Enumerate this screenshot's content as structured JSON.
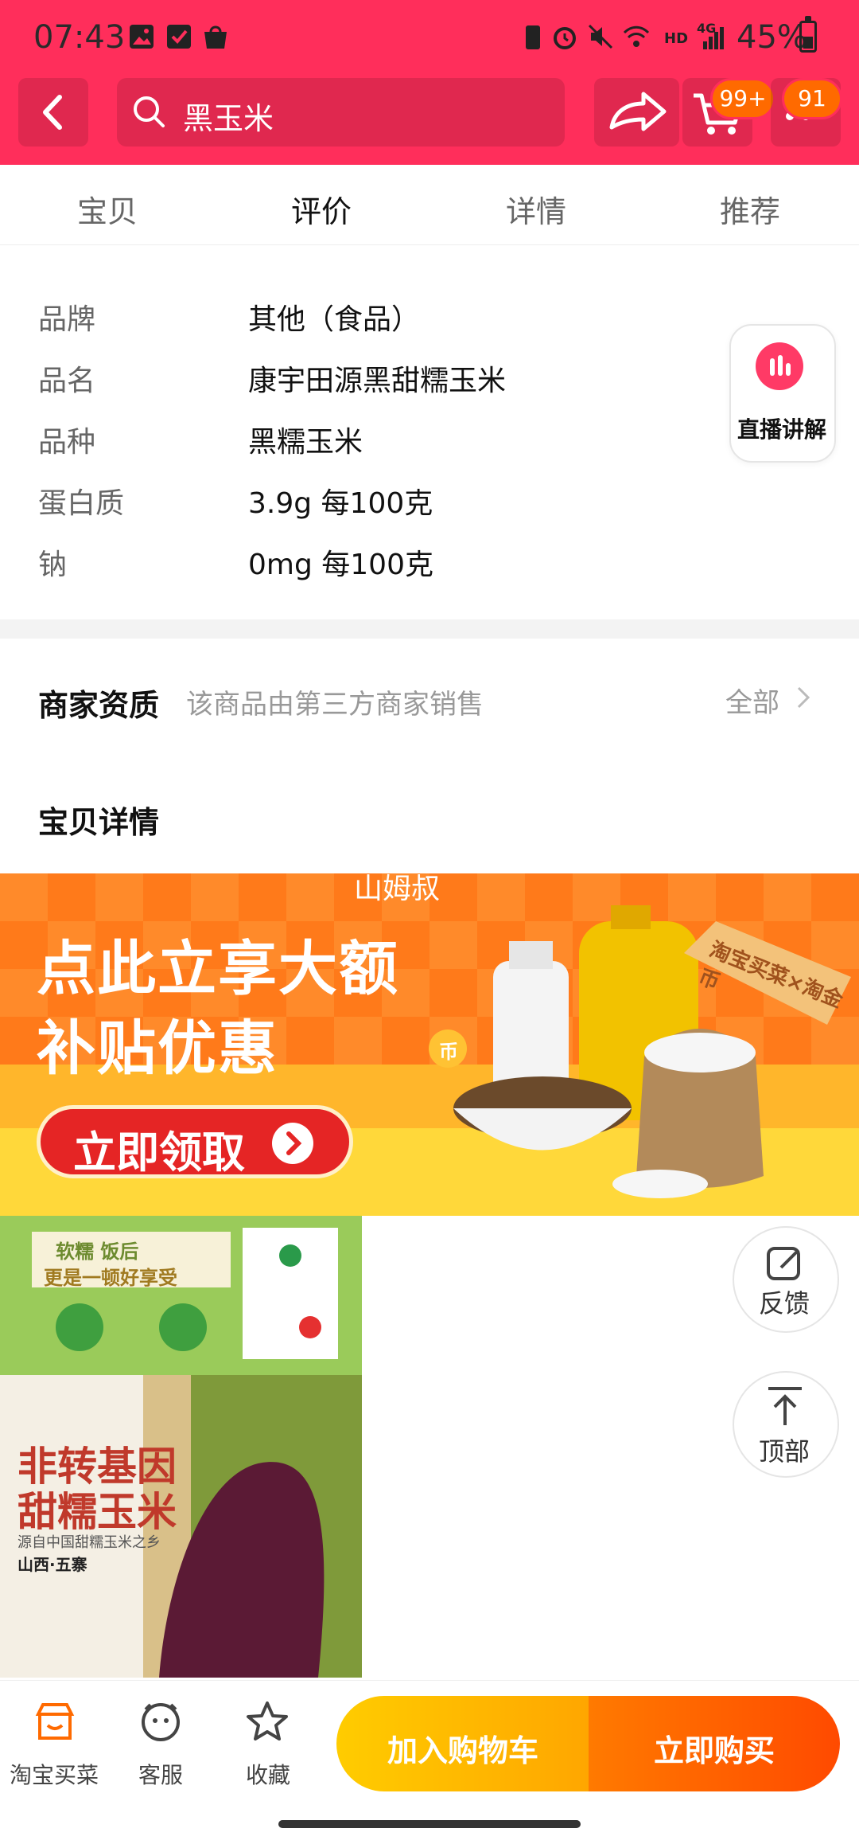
{
  "status_bar": {
    "time": "07:43",
    "battery_pct": "45%",
    "network": "4G",
    "hd": "HD"
  },
  "header": {
    "search_query": "黑玉米",
    "cart_badge": "99+",
    "msg_badge": "91"
  },
  "tabs": [
    "宝贝",
    "评价",
    "详情",
    "推荐"
  ],
  "active_tab": "评价",
  "specs": [
    {
      "label": "品牌",
      "value": "其他（食品）"
    },
    {
      "label": "品名",
      "value": "康宇田源黑甜糯玉米"
    },
    {
      "label": "品种",
      "value": "黑糯玉米"
    },
    {
      "label": "蛋白质",
      "value": "3.9g 每100克"
    },
    {
      "label": "钠",
      "value": "0mg 每100克"
    }
  ],
  "live_label": "直播讲解",
  "merchant": {
    "title": "商家资质",
    "desc": "该商品由第三方商家销售",
    "all": "全部"
  },
  "detail_title": "宝贝详情",
  "banner": {
    "top": "山姆叔",
    "line1": "点此立享大额",
    "line2": "补贴优惠",
    "button": "立即领取",
    "sign": "淘宝买菜×淘金币",
    "coin": "币"
  },
  "product_image": {
    "cert_text1": "软糯 饭后",
    "cert_text2": "更是一顿好享受",
    "headline1": "非转基因",
    "headline2": "甜糯玉米",
    "sub": "源自中国甜糯玉米之乡",
    "origin": "山西·五寨"
  },
  "floating": {
    "feedback": "反馈",
    "top": "顶部"
  },
  "bottom_bar": {
    "shop": "淘宝买菜",
    "service": "客服",
    "fav": "收藏",
    "add_cart": "加入购物车",
    "buy_now": "立即购买"
  },
  "colors": {
    "brand_red": "#ff2e5b",
    "orange": "#ff7a1a",
    "yellow": "#ffcc00"
  }
}
